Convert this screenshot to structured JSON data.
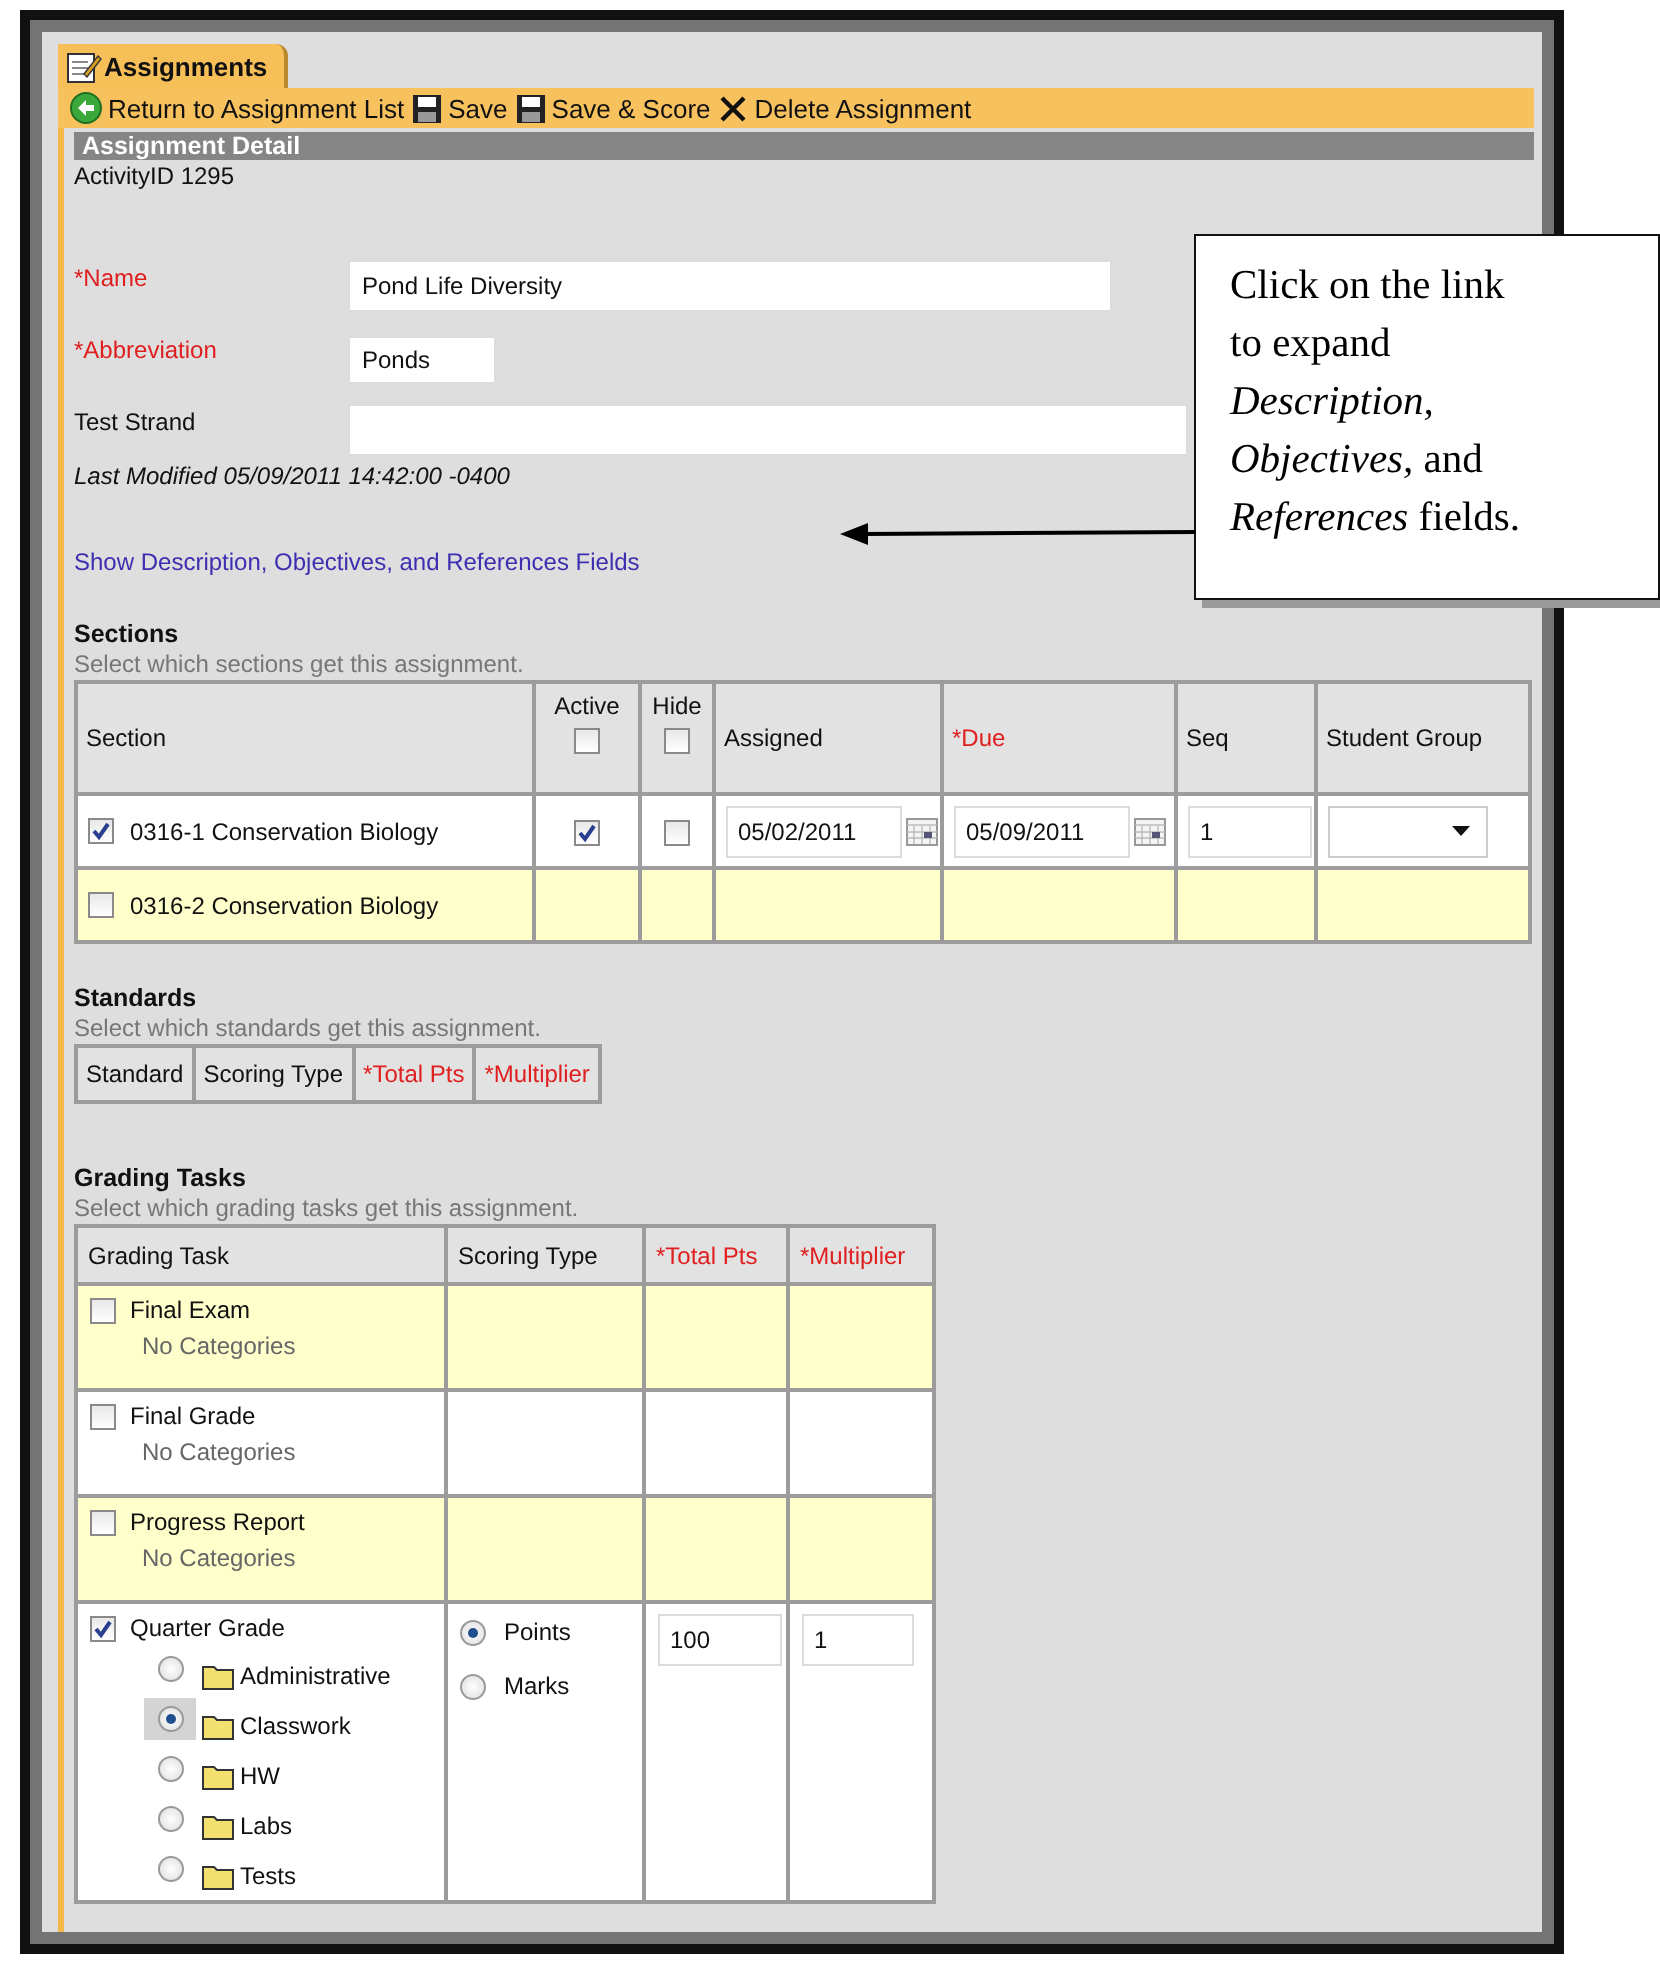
{
  "tab": {
    "label": "Assignments",
    "selected": true
  },
  "toolbar": [
    {
      "kind": "back",
      "label": "Return to Assignment List"
    },
    {
      "kind": "save",
      "label": "Save"
    },
    {
      "kind": "save",
      "label": "Save & Score"
    },
    {
      "kind": "delete",
      "label": "Delete Assignment"
    }
  ],
  "detail": {
    "title": "Assignment Detail",
    "activity_id": "ActivityID 1295",
    "fields": [
      {
        "label": "*Name",
        "required": true,
        "kind": "long",
        "value": "Pond Life Diversity"
      },
      {
        "label": "*Abbreviation",
        "required": true,
        "kind": "short",
        "value": "Ponds"
      },
      {
        "label": "Test Strand",
        "required": false,
        "kind": "full"
      }
    ],
    "last_modified": "Last Modified 05/09/2011 14:42:00 -0400",
    "link": "Show Description, Objectives, and References Fields"
  },
  "sections": {
    "title": "Sections",
    "subtitle": "Select which sections get this assignment.",
    "columns": [
      {
        "label": "Section",
        "required": false
      },
      {
        "label": "Active",
        "required": false,
        "checkbox": true,
        "checked": false
      },
      {
        "label": "Hide",
        "required": false,
        "checkbox": true,
        "checked": false
      },
      {
        "label": "Assigned",
        "required": false
      },
      {
        "label": "*Due",
        "required": true
      },
      {
        "label": "Seq",
        "required": false
      },
      {
        "label": "Student Group",
        "required": false
      }
    ],
    "rows": [
      {
        "checked": true,
        "shaded": false,
        "name": "0316-1 Conservation Biology",
        "active": true,
        "hide": false,
        "assigned": "05/02/2011",
        "due": "05/09/2011",
        "seq": "1"
      },
      {
        "checked": false,
        "shaded": true,
        "name": "0316-2 Conservation Biology"
      }
    ]
  },
  "standards": {
    "title": "Standards",
    "subtitle": "Select which standards get this assignment.",
    "columns": [
      {
        "label": "Standard",
        "required": false
      },
      {
        "label": "Scoring Type",
        "required": false
      },
      {
        "label": "*Total Pts",
        "required": true
      },
      {
        "label": "*Multiplier",
        "required": true
      }
    ]
  },
  "grading_tasks": {
    "title": "Grading Tasks",
    "subtitle": "Select which grading tasks get this assignment.",
    "columns": [
      {
        "label": "Grading Task",
        "required": false
      },
      {
        "label": "Scoring Type",
        "required": false
      },
      {
        "label": "*Total Pts",
        "required": true
      },
      {
        "label": "*Multiplier",
        "required": true
      }
    ],
    "rows": [
      {
        "checked": false,
        "shaded": true,
        "name": "Final Exam",
        "note": "No Categories"
      },
      {
        "checked": false,
        "shaded": false,
        "name": "Final Grade",
        "note": "No Categories"
      },
      {
        "checked": false,
        "shaded": true,
        "name": "Progress Report",
        "note": "No Categories"
      },
      {
        "checked": true,
        "shaded": false,
        "name": "Quarter Grade",
        "categories": [
          {
            "label": "Administrative",
            "selected": false
          },
          {
            "label": "Classwork",
            "selected": true
          },
          {
            "label": "HW",
            "selected": false
          },
          {
            "label": "Labs",
            "selected": false
          },
          {
            "label": "Tests",
            "selected": false
          }
        ],
        "scoring_types": [
          {
            "label": "Points",
            "selected": true
          },
          {
            "label": "Marks",
            "selected": false
          }
        ],
        "total_pts": "100",
        "multiplier": "1"
      }
    ]
  },
  "callout": {
    "lines": [
      "Click on the link",
      "to expand",
      "*Description,*",
      "*Objectives,* and",
      "*References* fields."
    ]
  }
}
